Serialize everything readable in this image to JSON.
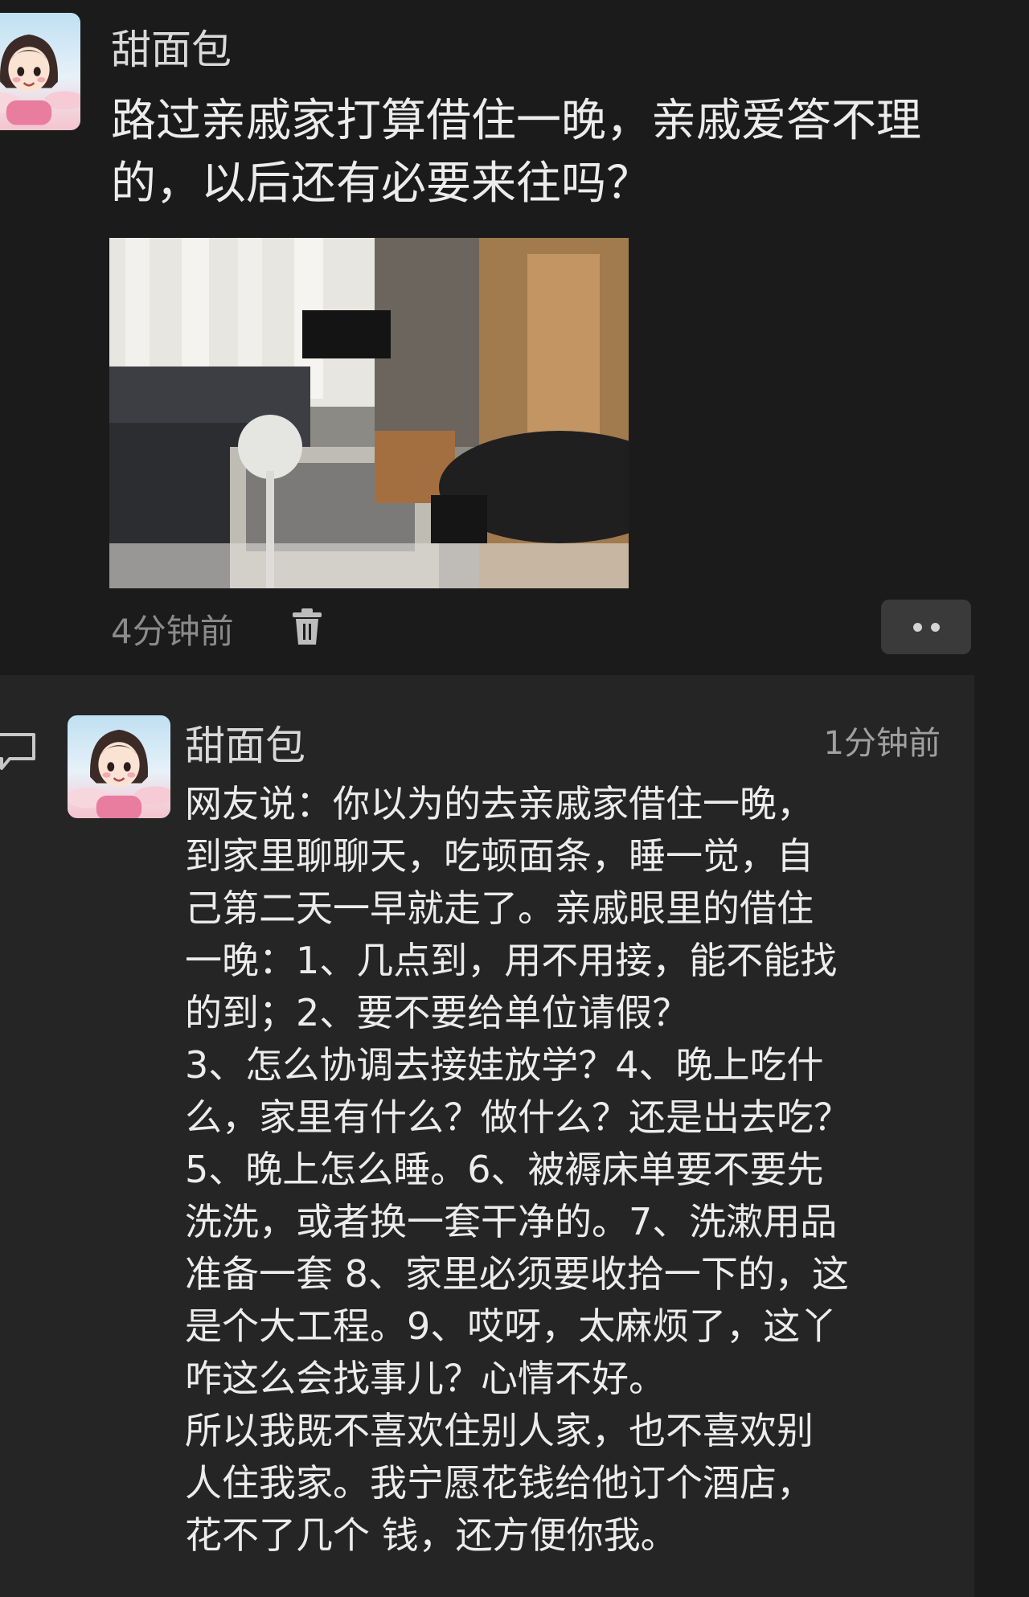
{
  "post": {
    "username": "甜面包",
    "text": "路过亲戚家打算借住一晚，亲戚爱答不理的，以后还有必要来往吗？",
    "time": "4分钟前",
    "icons": {
      "delete": "trash-icon",
      "more": "more-dots-icon"
    }
  },
  "comment": {
    "username": "甜面包",
    "time": "1分钟前",
    "text": "网友说：你以为的去亲戚家借住一晚，\n到家里聊聊天，吃顿面条，睡一觉，自\n己第二天一早就走了。亲戚眼里的借住\n一晚：1、几点到，用不用接，能不能找\n的到；2、要不要给单位请假？\n3、怎么协调去接娃放学？4、晚上吃什\n么，家里有什么？做什么？还是出去吃？\n5、晚上怎么睡。6、被褥床单要不要先\n洗洗，或者换一套干净的。7、洗漱用品\n准备一套 8、家里必须要收拾一下的，这\n是个大工程。9、哎呀，太麻烦了，这丫\n咋这么会找事儿？心情不好。\n所以我既不喜欢住别人家，也不喜欢别\n人住我家。我宁愿花钱给他订个酒店，\n花不了几个 钱，还方便你我。",
    "icons": {
      "reply": "comment-bubble-icon"
    }
  }
}
